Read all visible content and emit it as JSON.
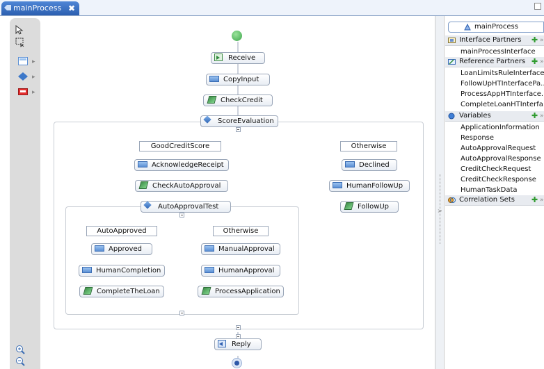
{
  "editor_tab": {
    "title": "mainProcess",
    "close": "✖"
  },
  "palette": {
    "items": [
      "select-tool",
      "marquee-tool",
      "assign-category",
      "choice-category",
      "fault-category"
    ]
  },
  "nodes": {
    "receive": "Receive",
    "copy_input": "CopyInput",
    "check_credit": "CheckCredit",
    "score_evaluation": "ScoreEvaluation",
    "good_credit_score": "GoodCreditScore",
    "otherwise_outer": "Otherwise",
    "acknowledge_receipt": "AcknowledgeReceipt",
    "check_auto_approval": "CheckAutoApproval",
    "auto_approval_test": "AutoApprovalTest",
    "auto_approved": "AutoApproved",
    "otherwise_inner": "Otherwise",
    "approved": "Approved",
    "human_completion": "HumanCompletion",
    "complete_the_loan": "CompleteTheLoan",
    "manual_approval": "ManualApproval",
    "human_approval": "HumanApproval",
    "process_application": "ProcessApplication",
    "declined": "Declined",
    "human_follow_up": "HumanFollowUp",
    "follow_up": "FollowUp",
    "reply": "Reply"
  },
  "tray": {
    "header": "mainProcess",
    "interface_partners": {
      "title": "Interface Partners",
      "items": [
        "mainProcessInterface"
      ]
    },
    "reference_partners": {
      "title": "Reference Partners",
      "items": [
        "LoanLimitsRuleInterface...",
        "FollowUpHTInterfacePa...",
        "ProcessAppHTInterface...",
        "CompleteLoanHTInterfa..."
      ]
    },
    "variables": {
      "title": "Variables",
      "items": [
        "ApplicationInformation",
        "Response",
        "AutoApprovalRequest",
        "AutoApprovalResponse",
        "CreditCheckRequest",
        "CreditCheckResponse",
        "HumanTaskData"
      ]
    },
    "correlation_sets": {
      "title": "Correlation Sets"
    },
    "add": "✚",
    "more": "»"
  },
  "colors": {
    "accent": "#2c5fb0",
    "start": "#3ba54a",
    "end": "#2d58a8"
  }
}
